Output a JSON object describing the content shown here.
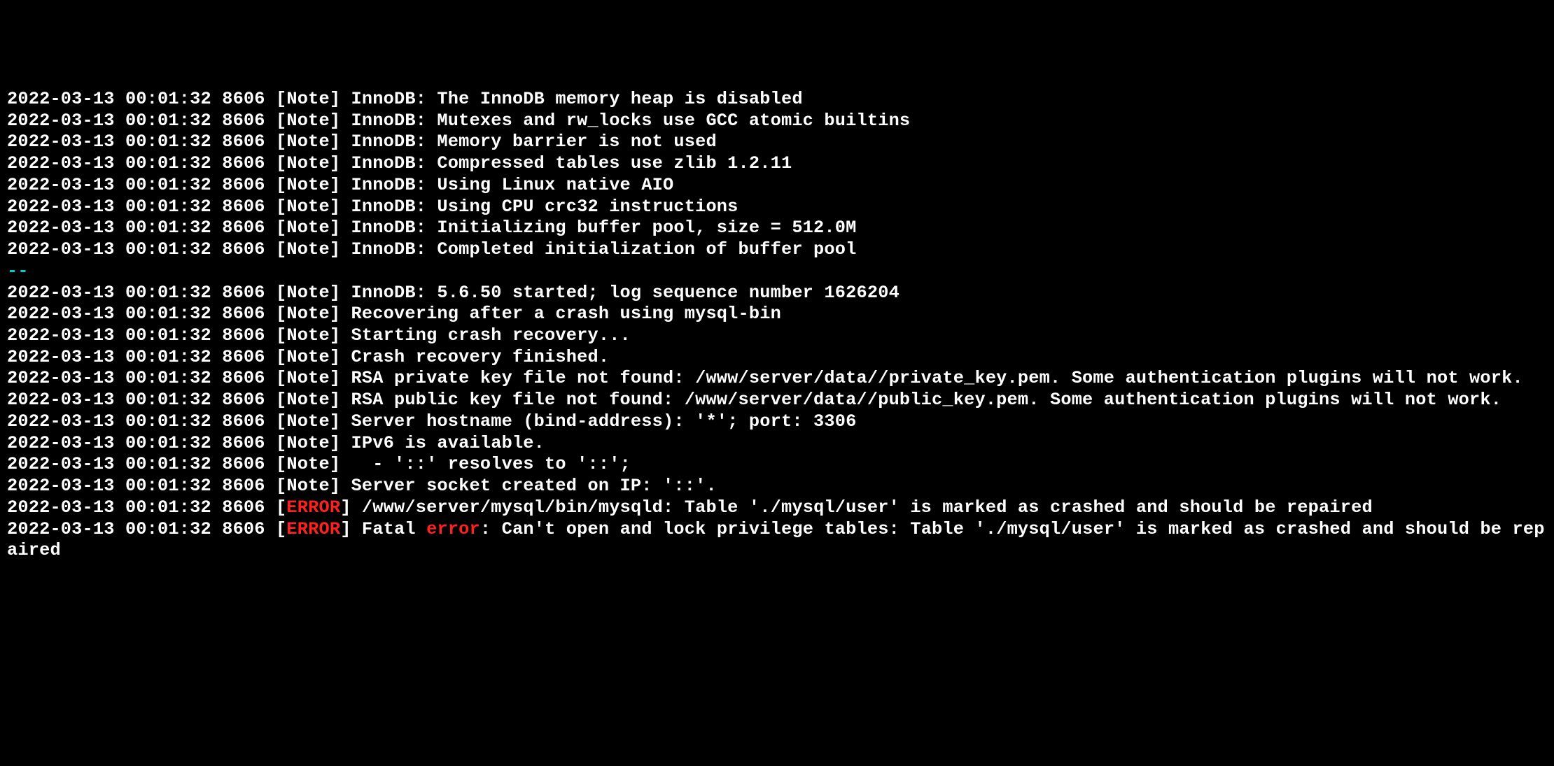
{
  "lines": [
    {
      "type": "plain",
      "text": "2022-03-13 00:01:32 8606 [Note] InnoDB: The InnoDB memory heap is disabled"
    },
    {
      "type": "plain",
      "text": "2022-03-13 00:01:32 8606 [Note] InnoDB: Mutexes and rw_locks use GCC atomic builtins"
    },
    {
      "type": "plain",
      "text": "2022-03-13 00:01:32 8606 [Note] InnoDB: Memory barrier is not used"
    },
    {
      "type": "plain",
      "text": "2022-03-13 00:01:32 8606 [Note] InnoDB: Compressed tables use zlib 1.2.11"
    },
    {
      "type": "plain",
      "text": "2022-03-13 00:01:32 8606 [Note] InnoDB: Using Linux native AIO"
    },
    {
      "type": "plain",
      "text": "2022-03-13 00:01:32 8606 [Note] InnoDB: Using CPU crc32 instructions"
    },
    {
      "type": "plain",
      "text": "2022-03-13 00:01:32 8606 [Note] InnoDB: Initializing buffer pool, size = 512.0M"
    },
    {
      "type": "plain",
      "text": "2022-03-13 00:01:32 8606 [Note] InnoDB: Completed initialization of buffer pool"
    },
    {
      "type": "cyan",
      "text": "--"
    },
    {
      "type": "plain",
      "text": "2022-03-13 00:01:32 8606 [Note] InnoDB: 5.6.50 started; log sequence number 1626204"
    },
    {
      "type": "plain",
      "text": "2022-03-13 00:01:32 8606 [Note] Recovering after a crash using mysql-bin"
    },
    {
      "type": "plain",
      "text": "2022-03-13 00:01:32 8606 [Note] Starting crash recovery..."
    },
    {
      "type": "plain",
      "text": "2022-03-13 00:01:32 8606 [Note] Crash recovery finished."
    },
    {
      "type": "plain",
      "text": "2022-03-13 00:01:32 8606 [Note] RSA private key file not found: /www/server/data//private_key.pem. Some authentication plugins will not work."
    },
    {
      "type": "plain",
      "text": "2022-03-13 00:01:32 8606 [Note] RSA public key file not found: /www/server/data//public_key.pem. Some authentication plugins will not work."
    },
    {
      "type": "plain",
      "text": "2022-03-13 00:01:32 8606 [Note] Server hostname (bind-address): '*'; port: 3306"
    },
    {
      "type": "plain",
      "text": "2022-03-13 00:01:32 8606 [Note] IPv6 is available."
    },
    {
      "type": "plain",
      "text": "2022-03-13 00:01:32 8606 [Note]   - '::' resolves to '::';"
    },
    {
      "type": "plain",
      "text": "2022-03-13 00:01:32 8606 [Note] Server socket created on IP: '::'."
    },
    {
      "type": "error1",
      "prefix": "2022-03-13 00:01:32 8606 [",
      "err": "ERROR",
      "suffix": "] /www/server/mysql/bin/mysqld: Table './mysql/user' is marked as crashed and should be repaired"
    },
    {
      "type": "error2",
      "prefix": "2022-03-13 00:01:32 8606 [",
      "err": "ERROR",
      "mid": "] Fatal ",
      "err2": "error",
      "suffix": ": Can't open and lock privilege tables: Table './mysql/user' is marked as crashed and should be repaired"
    }
  ]
}
